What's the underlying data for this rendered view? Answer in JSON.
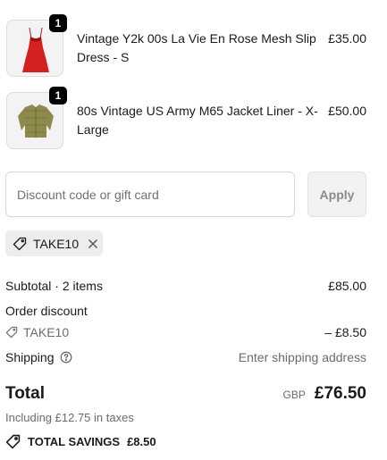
{
  "items": [
    {
      "title": "Vintage Y2k 00s La Vie En Rose Mesh Slip Dress - S",
      "price": "£35.00",
      "quantity": "1",
      "image": "red-slip-dress-thumbnail"
    },
    {
      "title": "80s Vintage US Army M65 Jacket Liner - X-Large",
      "price": "£50.00",
      "quantity": "1",
      "image": "olive-jacket-liner-thumbnail"
    }
  ],
  "discount": {
    "placeholder": "Discount code or gift card",
    "apply_label": "Apply",
    "applied_code": "TAKE10"
  },
  "summary": {
    "subtotal_label": "Subtotal · 2 items",
    "subtotal_value": "£85.00",
    "order_discount_label": "Order discount",
    "discount_code": "TAKE10",
    "discount_value": "– £8.50",
    "shipping_label": "Shipping",
    "shipping_value": "Enter shipping address",
    "total_label": "Total",
    "currency": "GBP",
    "total_value": "£76.50",
    "taxes_note": "Including £12.75 in taxes",
    "savings_label": "TOTAL SAVINGS",
    "savings_value": "£8.50"
  },
  "colors": {
    "text": "#1a1a1a",
    "muted": "#6b6b6b",
    "badge": "#000000",
    "apply_bg": "#f2f2f2",
    "chip_bg": "#ededed"
  }
}
